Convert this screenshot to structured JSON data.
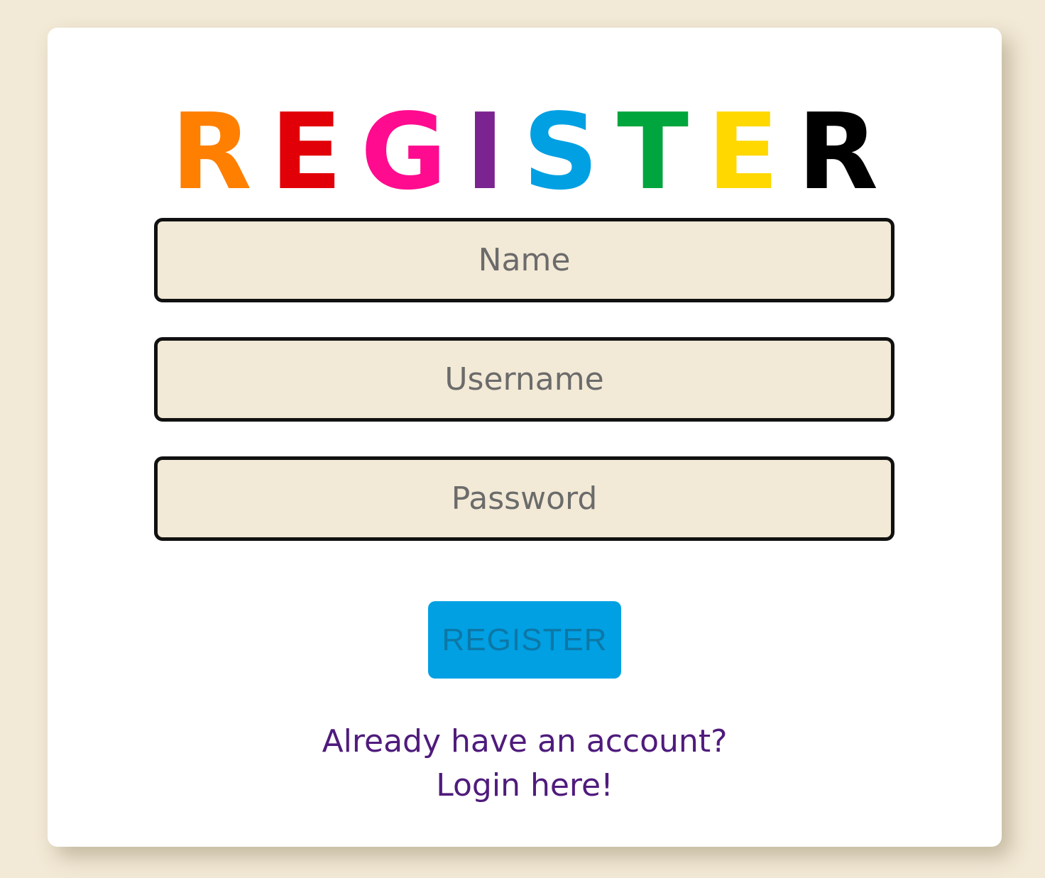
{
  "colors": {
    "background": "#f2e9d6",
    "card": "#ffffff",
    "input_fill": "#f2e9d6",
    "input_border": "#111111",
    "button": "#00a0e3",
    "button_text": "#0d77a6",
    "link": "#4f1b7c"
  },
  "title": {
    "letters": [
      {
        "char": "R",
        "color": "#ff7f00"
      },
      {
        "char": "E",
        "color": "#e10007"
      },
      {
        "char": "G",
        "color": "#ff0b8f"
      },
      {
        "char": "I",
        "color": "#7b2390"
      },
      {
        "char": "S",
        "color": "#00a0e3"
      },
      {
        "char": "T",
        "color": "#00a53d"
      },
      {
        "char": "E",
        "color": "#ffd800"
      },
      {
        "char": "R",
        "color": "#000000"
      }
    ]
  },
  "form": {
    "name_placeholder": "Name",
    "name_value": "",
    "username_placeholder": "Username",
    "username_value": "",
    "password_placeholder": "Password",
    "password_value": "",
    "submit_label": "REGISTER"
  },
  "login_link": {
    "line1": "Already have an account?",
    "line2": "Login here!"
  }
}
